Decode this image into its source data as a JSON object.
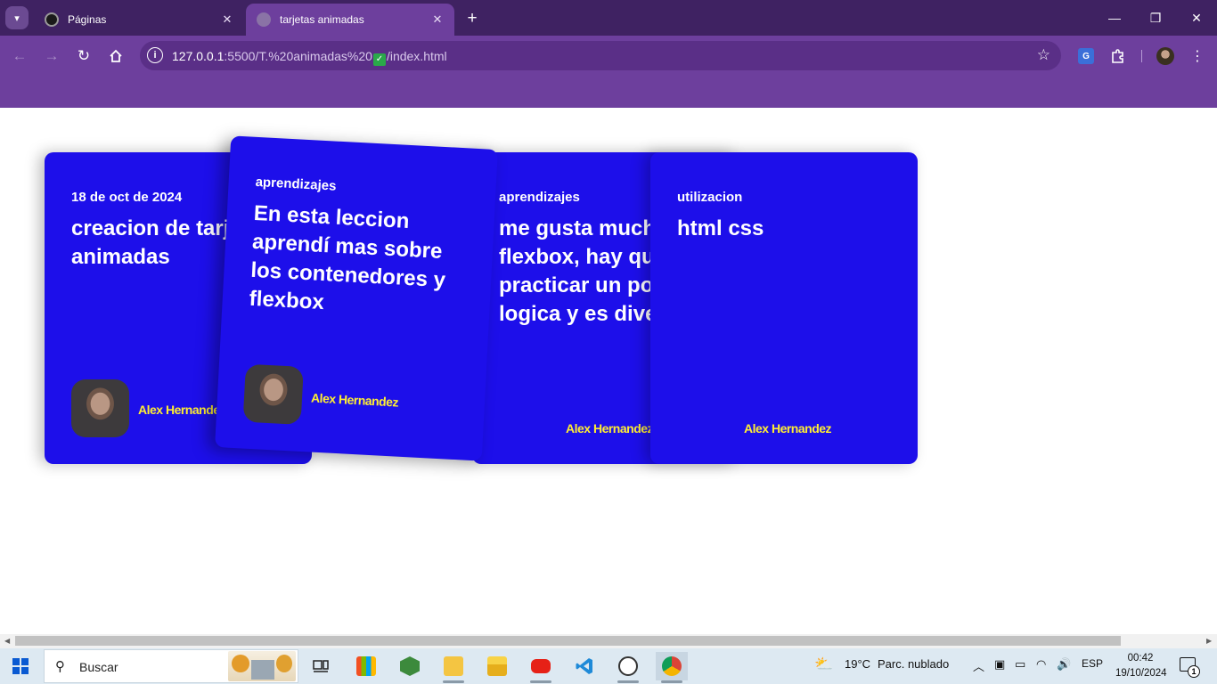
{
  "browser": {
    "tabs": [
      {
        "title": "Páginas",
        "icon": "github-icon"
      },
      {
        "title": "tarjetas animadas",
        "icon": "globe-icon",
        "active": true
      }
    ],
    "address": {
      "host": "127.0.0.1",
      "path_before": ":5500/T.%20animadas%20",
      "emoji": "✅",
      "path_after": "/index.html"
    }
  },
  "cards": [
    {
      "tag": "18 de oct de 2024",
      "text": "creacion de tarjetas animadas",
      "author": "Alex Hernandez"
    },
    {
      "tag": "aprendizajes",
      "text": "En esta leccion aprendí mas sobre los contenedores y flexbox",
      "author": "Alex Hernandez"
    },
    {
      "tag": "aprendizajes",
      "text": "me gusta mucho flexbox, hay que practicar un poco de logica y es divertido",
      "author": "Alex Hernandez"
    },
    {
      "tag": "utilizacion",
      "text": "html css",
      "author": "Alex Hernandez"
    }
  ],
  "taskbar": {
    "search_placeholder": "Buscar",
    "weather_temp": "19°C",
    "weather_desc": "Parc. nublado",
    "language": "ESP",
    "time": "00:42",
    "date": "19/10/2024",
    "notification_count": "1"
  },
  "colors": {
    "card_bg": "#1d0fea",
    "author_text": "#ffee33",
    "browser_frame": "#6d3f9d"
  }
}
